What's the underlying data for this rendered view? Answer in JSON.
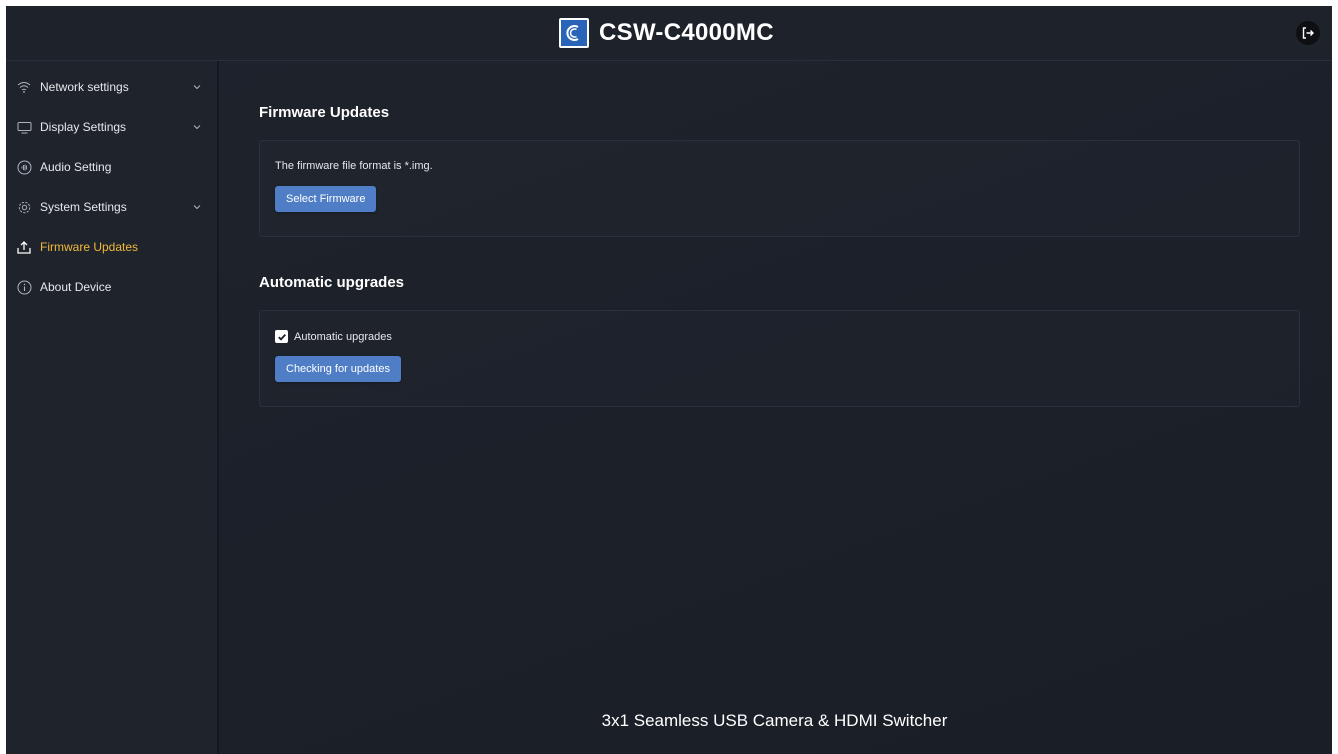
{
  "header": {
    "title": "CSW-C4000MC",
    "logo_icon": "c-logo-icon",
    "logout_icon": "logout-icon"
  },
  "sidebar": {
    "items": [
      {
        "label": "Network settings",
        "icon": "wifi-icon",
        "expandable": true
      },
      {
        "label": "Display Settings",
        "icon": "monitor-icon",
        "expandable": true
      },
      {
        "label": "Audio Setting",
        "icon": "audio-icon",
        "expandable": false
      },
      {
        "label": "System Settings",
        "icon": "gear-icon",
        "expandable": true
      },
      {
        "label": "Firmware Updates",
        "icon": "upload-icon",
        "expandable": false,
        "active": true
      },
      {
        "label": "About Device",
        "icon": "info-icon",
        "expandable": false
      }
    ]
  },
  "firmware": {
    "title": "Firmware Updates",
    "description": "The firmware file format is *.img.",
    "select_button": "Select Firmware"
  },
  "auto_upgrade": {
    "title": "Automatic upgrades",
    "checkbox_label": "Automatic upgrades",
    "checked": true,
    "check_button": "Checking for updates"
  },
  "footer": {
    "text": "3x1 Seamless USB Camera & HDMI Switcher"
  },
  "colors": {
    "accent": "#f2b93b",
    "button": "#4f7ec7",
    "logo": "#2a64b8"
  }
}
